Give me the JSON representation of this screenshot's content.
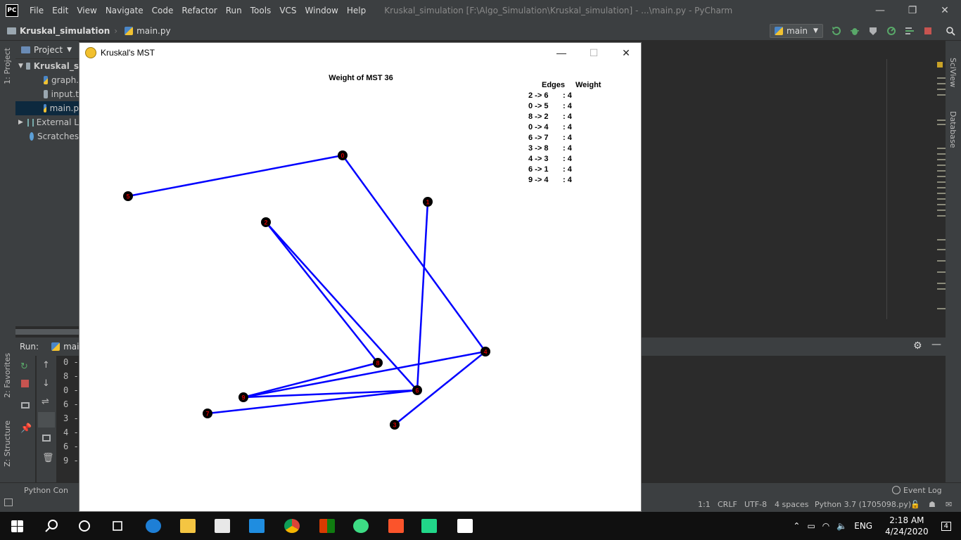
{
  "ide": {
    "menu": [
      "File",
      "Edit",
      "View",
      "Navigate",
      "Code",
      "Refactor",
      "Run",
      "Tools",
      "VCS",
      "Window",
      "Help"
    ],
    "window_title": "Kruskal_simulation [F:\\Algo_Simulation\\Kruskal_simulation] - ...\\main.py - PyCharm",
    "logo_text": "PC",
    "breadcrumb_project": "Kruskal_simulation",
    "breadcrumb_file": "main.py",
    "run_config": "main",
    "project_tab": "Project",
    "tree": [
      {
        "label": "Kruskal_s"
      },
      {
        "label": "graph."
      },
      {
        "label": "input.t"
      },
      {
        "label": "main.p"
      },
      {
        "label": "External L"
      },
      {
        "label": "Scratches"
      }
    ],
    "left_stripe": {
      "project": "1: Project",
      "favorites": "2: Favorites",
      "structure": "Z: Structure"
    },
    "right_stripe": {
      "sciview": "SciView",
      "database": "Database"
    },
    "run_label": "Run:",
    "run_tab": "mai",
    "console_lines": [
      "0 -",
      "8 -",
      "0 -",
      "6 -",
      "3 -",
      "4 -",
      "6 -",
      "9 -"
    ],
    "python_console": "Python Con",
    "event_log": "Event Log",
    "status": {
      "position": "1:1",
      "line_sep": "CRLF",
      "encoding": "UTF-8",
      "indent": "4 spaces",
      "interpreter": "Python 3.7 (1705098.py)"
    }
  },
  "pygame_window": {
    "title": "Kruskal's MST",
    "weight_label": "Weight of MST 36",
    "edges_header": "Edges",
    "weight_header": "Weight",
    "edge_rows": [
      {
        "edge": "2 -> 6",
        "weight": ": 4"
      },
      {
        "edge": "0 -> 5",
        "weight": ": 4"
      },
      {
        "edge": "8 -> 2",
        "weight": ": 4"
      },
      {
        "edge": "0 -> 4",
        "weight": ": 4"
      },
      {
        "edge": "6 -> 7",
        "weight": ": 4"
      },
      {
        "edge": "3 -> 8",
        "weight": ": 4"
      },
      {
        "edge": "4 -> 3",
        "weight": ": 4"
      },
      {
        "edge": "6 -> 1",
        "weight": ": 4"
      },
      {
        "edge": "9 -> 4",
        "weight": ": 4"
      }
    ],
    "edge_color": "#0000ff",
    "node_color": "#000000",
    "node_label_color": "#cc0000"
  },
  "taskbar": {
    "language": "ENG",
    "time": "2:18 AM",
    "date": "4/24/2020",
    "notifications": "4"
  }
}
